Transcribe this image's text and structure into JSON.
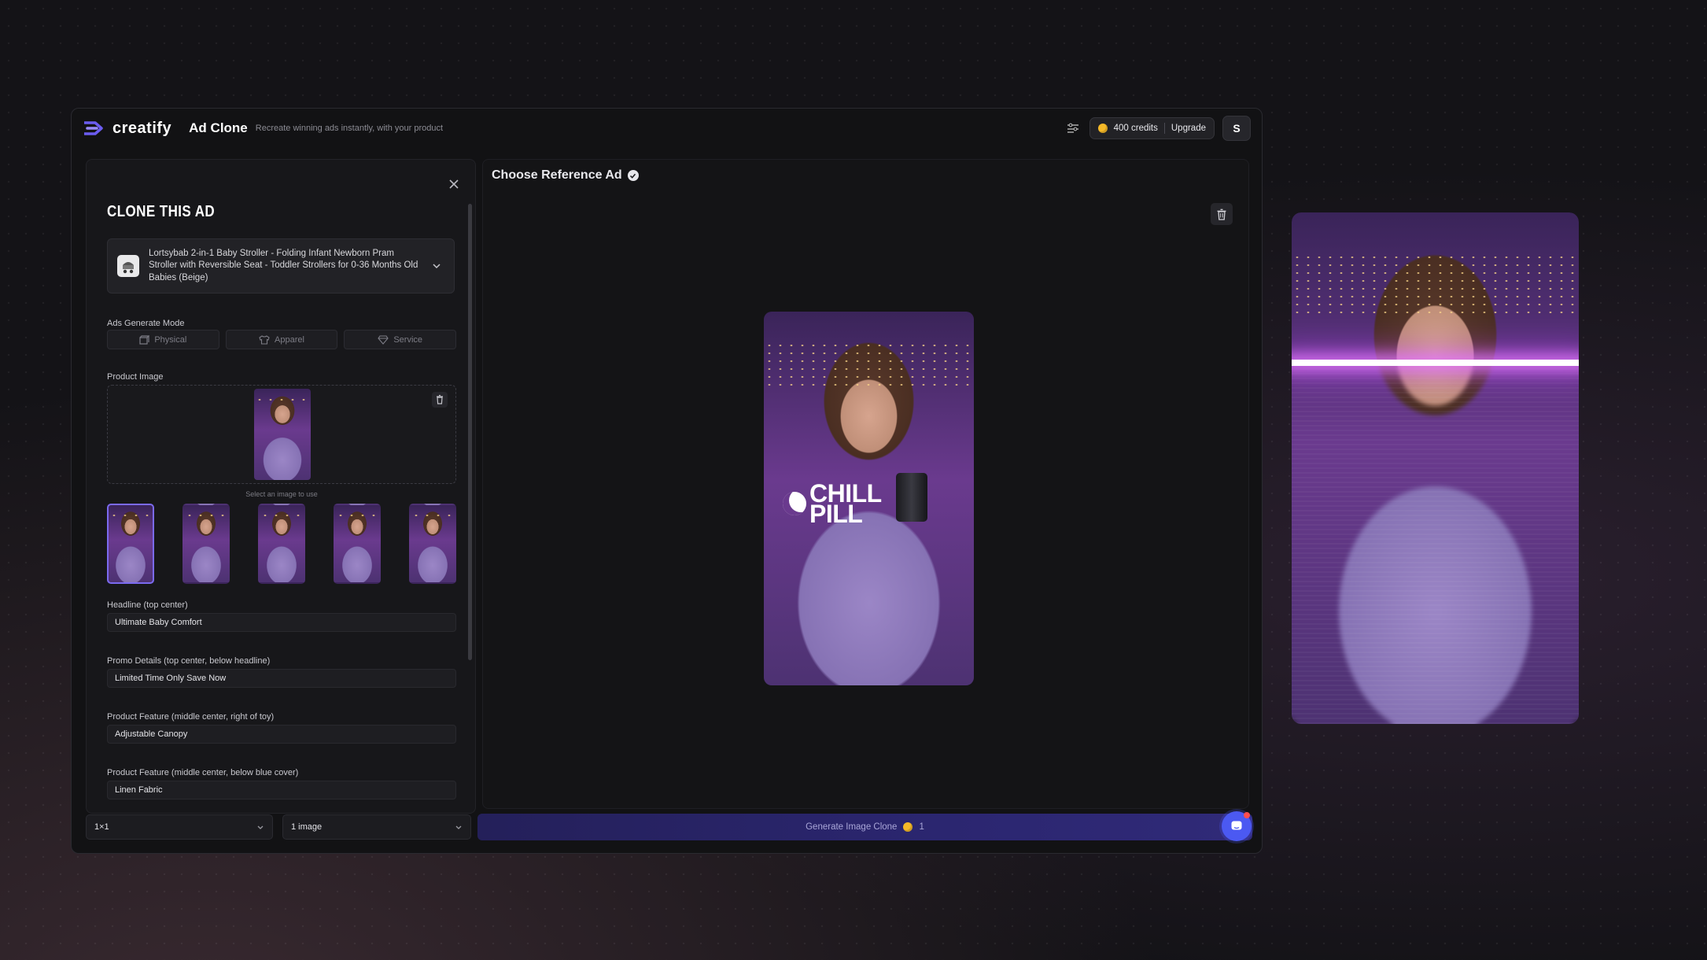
{
  "app": {
    "logo_text": "creatify",
    "title": "Ad Clone",
    "subtitle": "Recreate winning ads instantly, with your product",
    "credits": "400 credits",
    "upgrade": "Upgrade",
    "avatar_initial": "S"
  },
  "left_panel": {
    "title": "CLONE THIS AD",
    "product_name": "Lortsybab 2-in-1 Baby Stroller - Folding Infant Newborn Pram Stroller with Reversible Seat - Toddler Strollers for 0-36 Months Old Babies (Beige)",
    "mode_label": "Ads Generate Mode",
    "modes": [
      {
        "label": "Physical",
        "icon": "box-icon"
      },
      {
        "label": "Apparel",
        "icon": "shirt-icon"
      },
      {
        "label": "Service",
        "icon": "diamond-icon"
      }
    ],
    "product_image_label": "Product Image",
    "select_hint": "Select an image to use",
    "fields": [
      {
        "label": "Headline (top center)",
        "value": "Ultimate Baby Comfort"
      },
      {
        "label": "Promo Details (top center, below headline)",
        "value": "Limited Time Only Save Now"
      },
      {
        "label": "Product Feature (middle center, right of toy)",
        "value": "Adjustable Canopy"
      },
      {
        "label": "Product Feature (middle center, below blue cover)",
        "value": "Linen Fabric"
      }
    ]
  },
  "bottom": {
    "aspect_ratio": "1×1",
    "image_count": "1 image",
    "generate_label": "Generate Image Clone",
    "generate_cost": "1"
  },
  "reference": {
    "title": "Choose Reference Ad",
    "brand_text_1": "CHILL",
    "brand_text_2": "PILL"
  },
  "colors": {
    "accent": "#7b6af0",
    "generate_button": "#2b2670",
    "chat_button": "#4b59f2",
    "coin": "#f5b928"
  }
}
